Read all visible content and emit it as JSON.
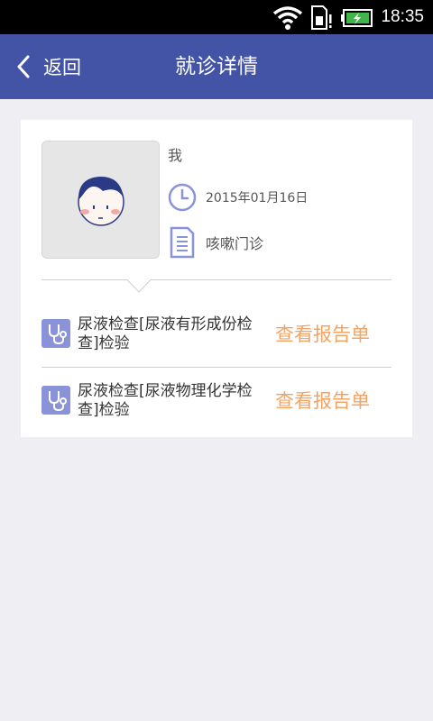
{
  "status_bar": {
    "time": "18:35",
    "icons": [
      "wifi-icon",
      "sim-card-icon",
      "battery-charging-icon"
    ]
  },
  "nav": {
    "back_label": "返回",
    "title": "就诊详情"
  },
  "patient": {
    "name": "我",
    "date": "2015年01月16日",
    "department": "咳嗽门诊"
  },
  "exams": [
    {
      "name": "尿液检查[尿液有形成份检查]检验",
      "action": "查看报告单"
    },
    {
      "name": "尿液检查[尿液物理化学检查]检验",
      "action": "查看报告单"
    }
  ],
  "colors": {
    "nav": "#4353a6",
    "accent": "#f3a465",
    "icon": "#8a93d8",
    "background": "#eeeef3"
  }
}
